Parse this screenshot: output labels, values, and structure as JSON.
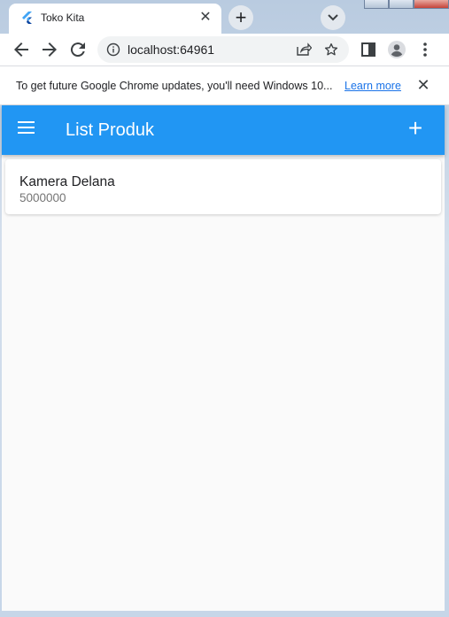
{
  "browser": {
    "tab": {
      "title": "Toko Kita",
      "close_glyph": "✕"
    },
    "new_tab_glyph": "+",
    "address": {
      "url": "localhost:64961"
    },
    "infobar": {
      "message": "To get future Google Chrome updates, you'll need Windows 10...",
      "link": "Learn more",
      "close_glyph": "✕"
    }
  },
  "app": {
    "title": "List Produk",
    "add_glyph": "+",
    "products": [
      {
        "name": "Kamera Delana",
        "price": "5000000"
      }
    ]
  },
  "colors": {
    "app_bar": "#2196f3",
    "link": "#1a73e8"
  },
  "icons": [
    "flutter-icon",
    "back-icon",
    "forward-icon",
    "reload-icon",
    "info-icon",
    "share-icon",
    "star-icon",
    "sidebar-icon",
    "profile-icon",
    "kebab-menu-icon",
    "menu-icon",
    "add-icon"
  ]
}
